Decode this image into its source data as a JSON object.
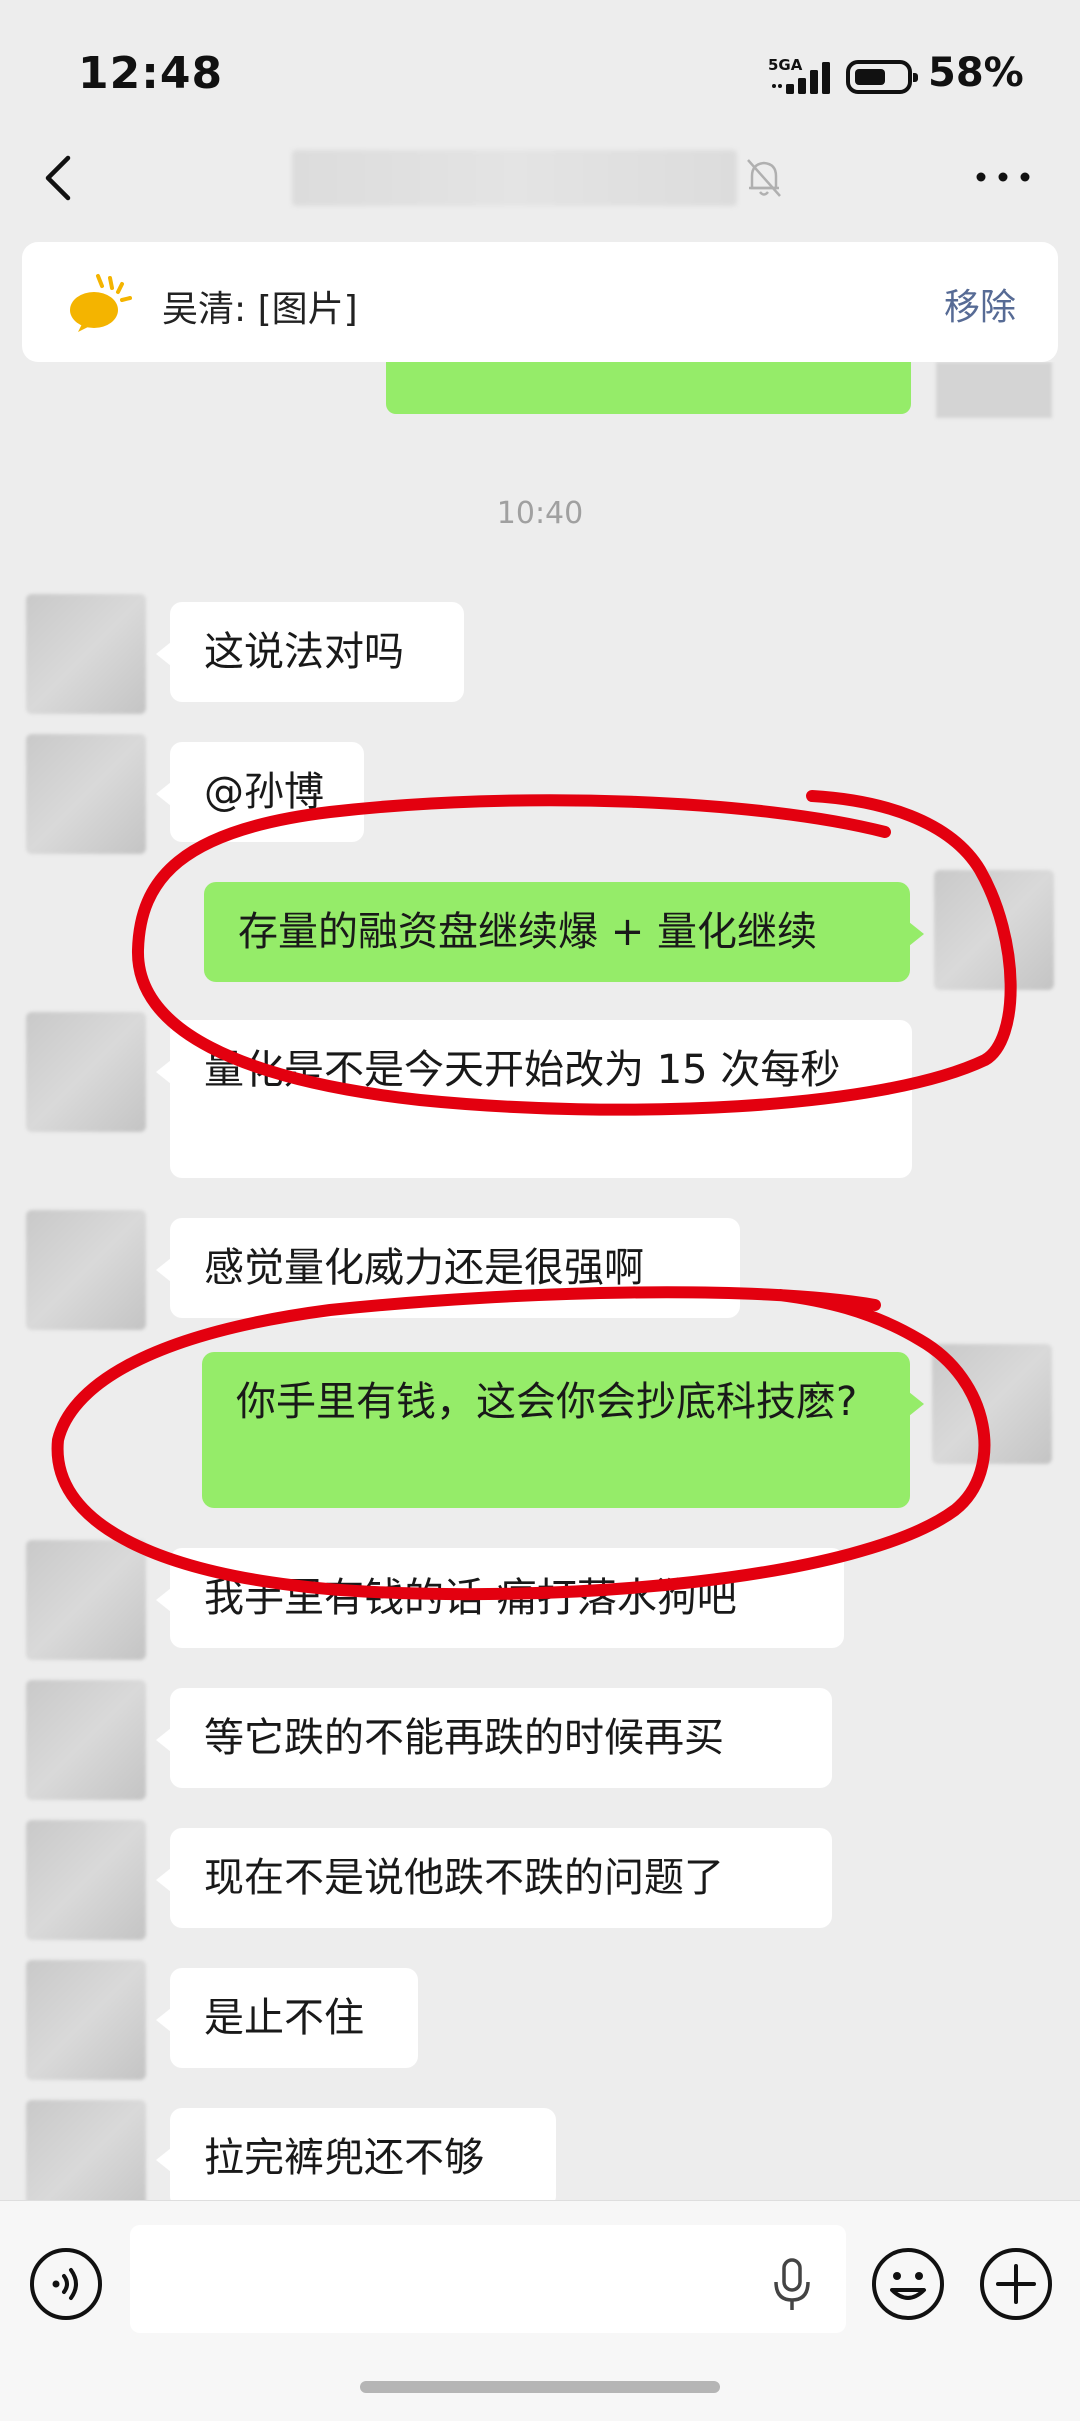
{
  "status_bar": {
    "time": "12:48",
    "network": "5GA",
    "battery_percent": "58%"
  },
  "nav": {
    "back_icon": "chevron-left-icon",
    "mute_icon": "bell-off-icon",
    "more_icon": "more-dots-icon"
  },
  "pinned": {
    "text": "吴清: [图片]",
    "remove_label": "移除"
  },
  "chat": {
    "timestamp": "10:40",
    "messages": [
      {
        "side": "in",
        "text": "这说法对吗"
      },
      {
        "side": "in",
        "text": "@孙博"
      },
      {
        "side": "out",
        "text": "存量的融资盘继续爆 + 量化继续"
      },
      {
        "side": "in",
        "text": "量化是不是今天开始改为 15 次每秒"
      },
      {
        "side": "in",
        "text": "感觉量化威力还是很强啊"
      },
      {
        "side": "out",
        "text": "你手里有钱，这会你会抄底科技麽?"
      },
      {
        "side": "in",
        "text": "我手里有钱的话 痛打落水狗吧"
      },
      {
        "side": "in",
        "text": "等它跌的不能再跌的时候再买"
      },
      {
        "side": "in",
        "text": "现在不是说他跌不跌的问题了"
      },
      {
        "side": "in",
        "text": "是止不住"
      },
      {
        "side": "in",
        "text": "拉完裤兜还不够"
      }
    ]
  },
  "colors": {
    "outgoing_bubble": "#95ec69",
    "incoming_bubble": "#ffffff",
    "annotation_red": "#e3000f",
    "link_blue": "#576b95"
  },
  "input_bar": {
    "voice_icon": "voice-wave-icon",
    "mic_icon": "microphone-icon",
    "emoji_icon": "smiley-icon",
    "plus_icon": "plus-circle-icon",
    "input_value": ""
  }
}
